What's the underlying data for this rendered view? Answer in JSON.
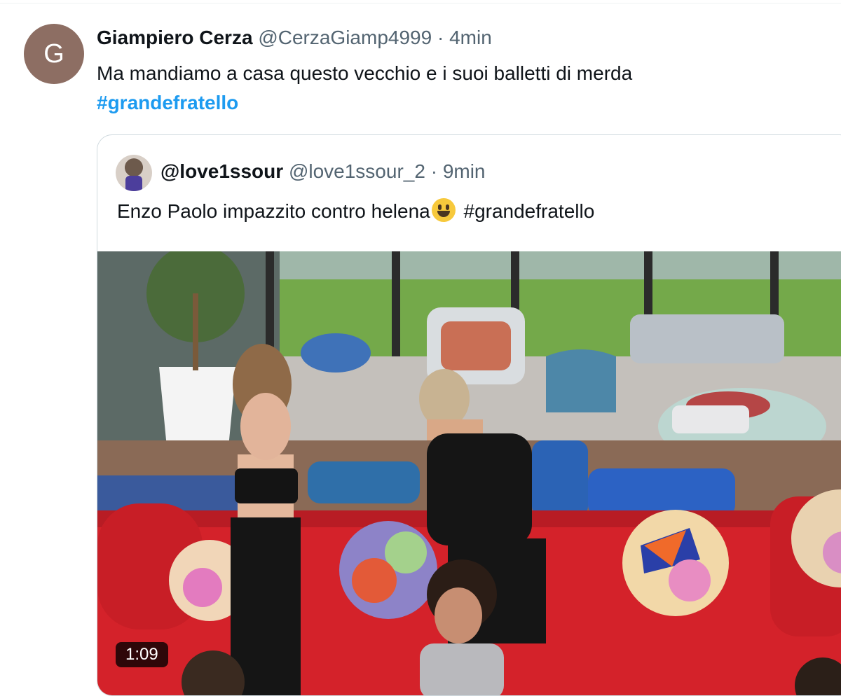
{
  "tweet": {
    "avatar_letter": "G",
    "author_name": "Giampiero Cerza",
    "handle": "@CerzaGiamp4999",
    "separator": "·",
    "time": "4min",
    "text": "Ma mandiamo a casa questo vecchio e i suoi balletti di merda",
    "hashtag": "#grandefratello"
  },
  "quoted_tweet": {
    "author_name": "@love1ssour",
    "handle": "@love1ssour_2",
    "separator": "·",
    "time": "9min",
    "text": "Enzo Paolo impazzito contro helena",
    "emoji": "smiling-face-icon",
    "hashtag": "#grandefratello",
    "video_duration": "1:09"
  },
  "colors": {
    "link": "#1d9bf0",
    "secondary_text": "#536471",
    "avatar_bg": "#8d6e63"
  }
}
